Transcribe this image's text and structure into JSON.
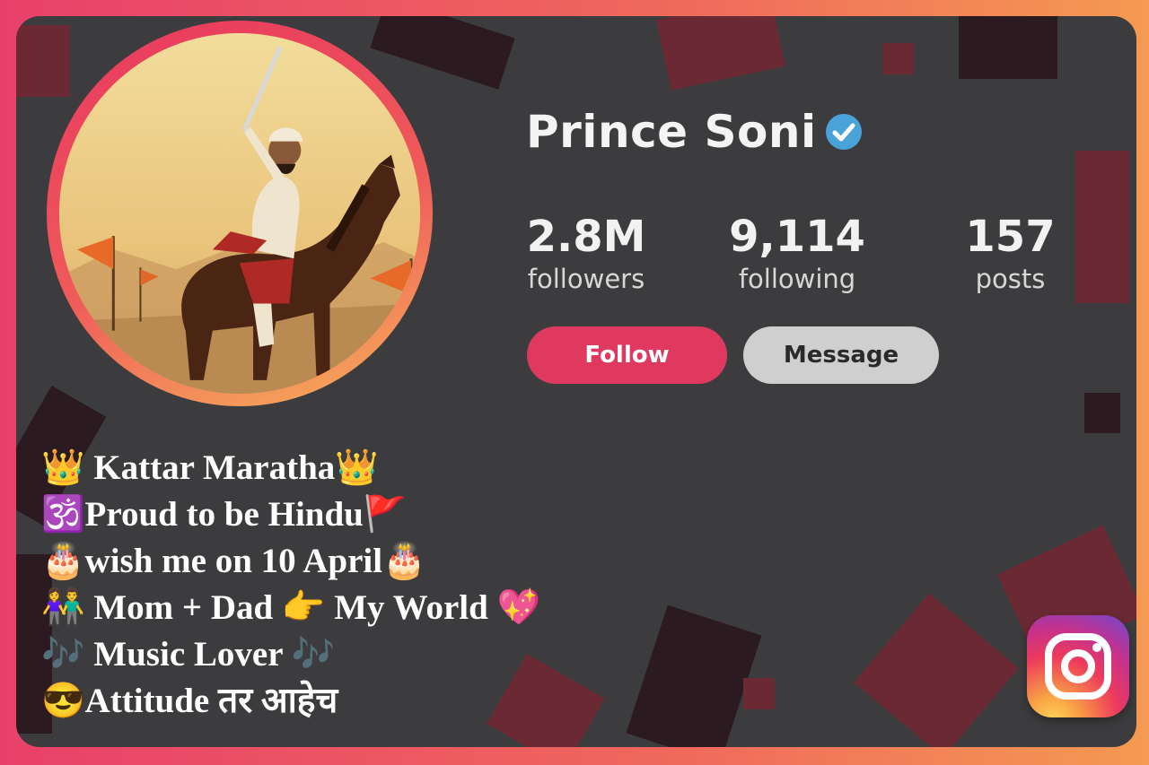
{
  "profile": {
    "name": "Prince Soni",
    "verified": true
  },
  "stats": [
    {
      "value": "2.8M",
      "label": "followers"
    },
    {
      "value": "9,114",
      "label": "following"
    },
    {
      "value": "157",
      "label": "posts"
    }
  ],
  "actions": {
    "follow_label": "Follow",
    "message_label": "Message"
  },
  "bio": [
    "👑 Kattar Maratha👑",
    "🕉️Proud to be Hindu🚩",
    "🎂wish me on 10 April🎂",
    "👫 Mom + Dad 👉 My World 💖",
    "🎶 Music Lover 🎶",
    "😎Attitude तर आहेच"
  ],
  "colors": {
    "accent": "#e0395f",
    "message_button": "#cfcfcf",
    "card_bg": "#3c3c3e",
    "verified_badge": "#4aa3d8"
  },
  "icons": {
    "verified": "verified-check-icon",
    "app": "instagram-logo-icon"
  }
}
